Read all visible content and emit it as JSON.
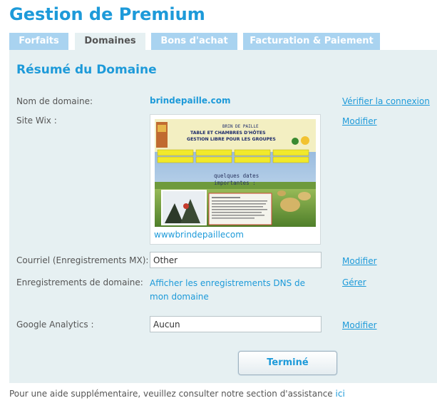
{
  "header": {
    "title": "Gestion de Premium"
  },
  "tabs": [
    {
      "label": "Forfaits"
    },
    {
      "label": "Domaines"
    },
    {
      "label": "Bons d'achat"
    },
    {
      "label": "Facturation & Paiement"
    }
  ],
  "summary": {
    "title": "Résumé du Domaine",
    "domain_label": "Nom de domaine:",
    "domain_value": "brindepaille.com",
    "verify_link": "Vérifier la connexion",
    "site_label": "Site Wix :",
    "site_modify": "Modifier",
    "site_caption": "wwwbrindepaillecom",
    "thumbnail": {
      "title_line1": "BRIN DE PAILLE",
      "title_line2": "TABLE ET CHAMBRES D'HÔTES",
      "title_line3": "GESTION LIBRE POUR LES GROUPES",
      "body_line1": "quelques dates",
      "body_line2": "importantes :"
    },
    "mx_label": "Courriel (Enregistrements MX):",
    "mx_value": "Other",
    "mx_modify": "Modifier",
    "dns_label": "Enregistrements de domaine:",
    "dns_link": "Afficher les enregistrements DNS de mon domaine",
    "dns_manage": "Gérer",
    "ga_label": "Google Analytics :",
    "ga_value": "Aucun",
    "ga_modify": "Modifier",
    "done_label": "Terminé"
  },
  "help": {
    "text": "Pour une aide supplémentaire, veuillez consulter notre section d'assistance ",
    "link": "ici"
  },
  "colors": {
    "accent": "#1d9ad9",
    "panel": "#e6f0f2",
    "tab_inactive": "#a9d3f0"
  }
}
